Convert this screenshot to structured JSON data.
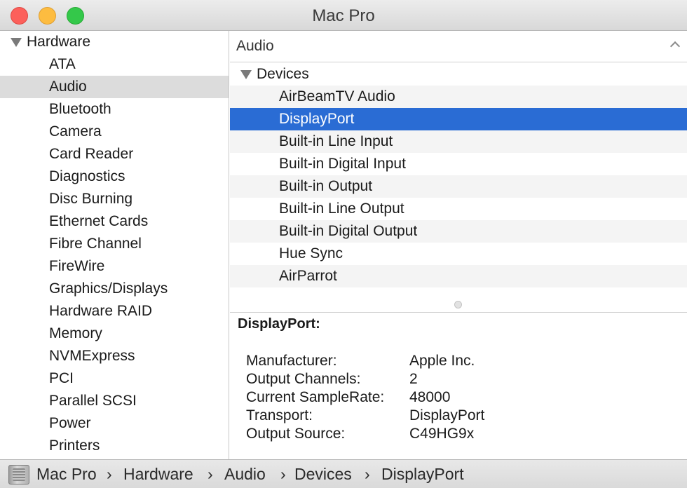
{
  "window": {
    "title": "Mac Pro"
  },
  "sidebar": {
    "group": "Hardware",
    "items": [
      "ATA",
      "Audio",
      "Bluetooth",
      "Camera",
      "Card Reader",
      "Diagnostics",
      "Disc Burning",
      "Ethernet Cards",
      "Fibre Channel",
      "FireWire",
      "Graphics/Displays",
      "Hardware RAID",
      "Memory",
      "NVMExpress",
      "PCI",
      "Parallel SCSI",
      "Power",
      "Printers"
    ],
    "selected": "Audio"
  },
  "content": {
    "section_title": "Audio",
    "group": "Devices",
    "devices": [
      "AirBeamTV Audio",
      "DisplayPort",
      "Built-in Line Input",
      "Built-in Digital Input",
      "Built-in Output",
      "Built-in Line Output",
      "Built-in Digital Output",
      "Hue Sync",
      "AirParrot"
    ],
    "selected_device": "DisplayPort"
  },
  "detail": {
    "title": "DisplayPort:",
    "fields": [
      {
        "key": "Manufacturer:",
        "value": "Apple Inc."
      },
      {
        "key": "Output Channels:",
        "value": "2"
      },
      {
        "key": "Current SampleRate:",
        "value": "48000"
      },
      {
        "key": "Transport:",
        "value": "DisplayPort"
      },
      {
        "key": "Output Source:",
        "value": "C49HG9x"
      }
    ]
  },
  "pathbar": {
    "crumbs": [
      "Mac Pro",
      "Hardware",
      "Audio",
      "Devices",
      "DisplayPort"
    ],
    "separator": "›"
  },
  "colors": {
    "selection": "#2a6cd4",
    "sidebar_selection": "#dcdcdc",
    "close": "#fc605b",
    "minimize": "#fdbc40",
    "maximize": "#34c84a"
  },
  "icons": [
    "close-button",
    "minimize-button",
    "zoom-button",
    "disclosure-triangle-icon",
    "chevron-up-icon",
    "mac-pro-icon"
  ]
}
